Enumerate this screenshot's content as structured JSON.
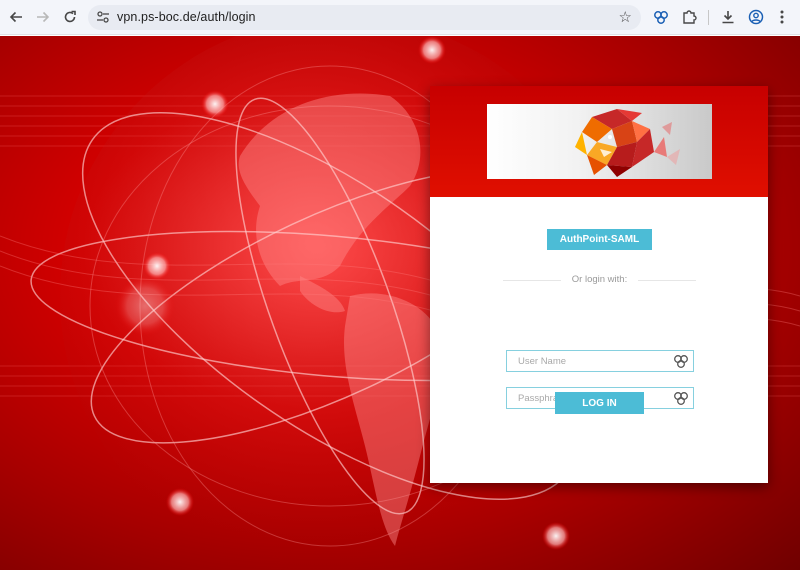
{
  "browser": {
    "url": "vpn.ps-boc.de/auth/login",
    "icons": [
      "back-arrow-icon",
      "forward-arrow-icon",
      "reload-icon",
      "site-settings-icon",
      "bookmark-star-icon",
      "extension-icon",
      "puzzle-icon",
      "download-icon",
      "profile-icon",
      "menu-dots-icon"
    ]
  },
  "login": {
    "saml_button": "AuthPoint-SAML",
    "divider_text": "Or login with:",
    "username_placeholder": "User Name",
    "password_placeholder": "Passphrase",
    "login_button": "LOG IN"
  },
  "colors": {
    "accent": "#4cbcd6",
    "header_red": "#d40000",
    "field_border": "#86d0df"
  }
}
